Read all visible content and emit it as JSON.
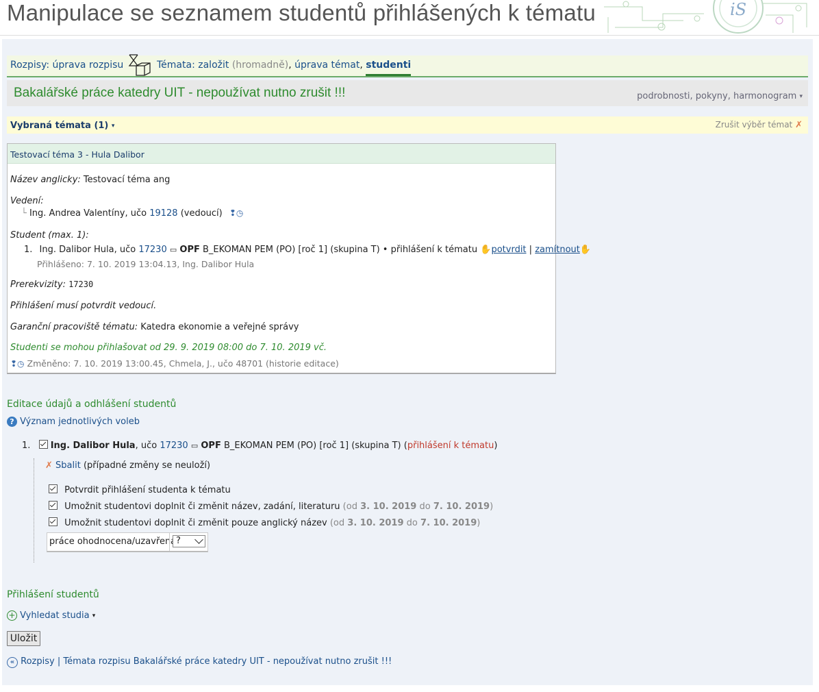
{
  "page_title": "Manipulace se seznamem studentů přihlášených k tématu",
  "logo_text": "iS",
  "nav": {
    "rozpisy_label": "Rozpisy:",
    "uprava_rozpisu": "úprava rozpisu",
    "temata_label": "Témata:",
    "zalozit": "založit",
    "hromadne": "(hromadně)",
    "sep1": ",",
    "uprava_temat": "úprava témat",
    "sep2": ",",
    "studenti": "studenti"
  },
  "schedule_title": "Bakalářské práce katedry UIT - nepoužívat nutno zrušit !!!",
  "schedule_links": "podrobnosti, pokyny, harmonogram",
  "selected_topics": {
    "label": "Vybraná témata (1)",
    "cancel": "Zrušit výběr témat"
  },
  "topic": {
    "header": "Testovací téma 3 - Hula Dalibor",
    "name_en_label": "Název anglicky:",
    "name_en_value": "Testovací téma ang",
    "supervision_label": "Vedení:",
    "supervisor_name": "Ing. Andrea Valentíny, učo",
    "supervisor_uco": "19128",
    "supervisor_role": "(vedoucí)",
    "student_label": "Student (max. 1):",
    "student_num": "1.",
    "student_name": "Ing. Dalibor Hula, učo",
    "student_uco": "17230",
    "student_fac": "OPF",
    "student_prog": "B_EKOMAN PEM (PO) [roč 1] (skupina T) • přihlášení k tématu",
    "confirm": "potvrdit",
    "pipe": "|",
    "reject": "zamítnout",
    "signed_in": "Přihlášeno: 7. 10. 2019 13:04.13, Ing. Dalibor Hula",
    "prereq_label": "Prerekvizity:",
    "prereq_value": "17230",
    "must_confirm": "Přihlášení musí potvrdit vedoucí.",
    "guarantor_label": "Garanční pracoviště tématu:",
    "guarantor_value": "Katedra ekonomie a veřejné správy",
    "registration_window": "Studenti se mohou přihlašovat od 29. 9. 2019 08:00 do 7. 10. 2019 vč.",
    "changed": "Změněno: 7. 10. 2019 13:00.45, Chmela, J., učo 48701 (historie editace)"
  },
  "edit_section": {
    "heading": "Editace údajů a odhlášení studentů",
    "meaning_link": "Význam jednotlivých voleb",
    "student_num": "1.",
    "student_name": "Ing. Dalibor Hula",
    "uco_label": ", učo",
    "student_uco": "17230",
    "student_fac": "OPF",
    "student_prog": "B_EKOMAN PEM (PO) [roč 1] (skupina T) (",
    "registration_status": "přihlášení k tématu",
    "close_paren": ")",
    "collapse_link": "Sbalit",
    "collapse_note": "(případné změny se neuloží)",
    "opt1": "Potvrdit přihlášení studenta k tématu",
    "opt2": "Umožnit studentovi doplnit či změnit název, zadání, literaturu",
    "opt3": "Umožnit studentovi doplnit či změnit pouze anglický název",
    "od": "(od",
    "date_from": "3. 10. 2019",
    "do": "do",
    "date_to": "7. 10. 2019",
    "close": ")",
    "evaluated_label": "práce ohodnocena/uzavřena",
    "evaluated_value": "?"
  },
  "login_section": {
    "heading": "Přihlášení studentů",
    "search_link": "Vyhledat studia"
  },
  "save_button": "Uložit",
  "footer": {
    "rozpisy": "Rozpisy",
    "pipe": "|",
    "temata": "Témata rozpisu Bakalářské práce katedry UIT - nepoužívat nutno zrušit !!!"
  },
  "colors": {
    "accent_green": "#2e8b2e",
    "link_blue": "#1a4f8a",
    "content_bg": "#eef2f8",
    "nav_bg": "#f3f8e4",
    "selection_bg": "#fefcd6",
    "status_red": "#c0392b"
  }
}
